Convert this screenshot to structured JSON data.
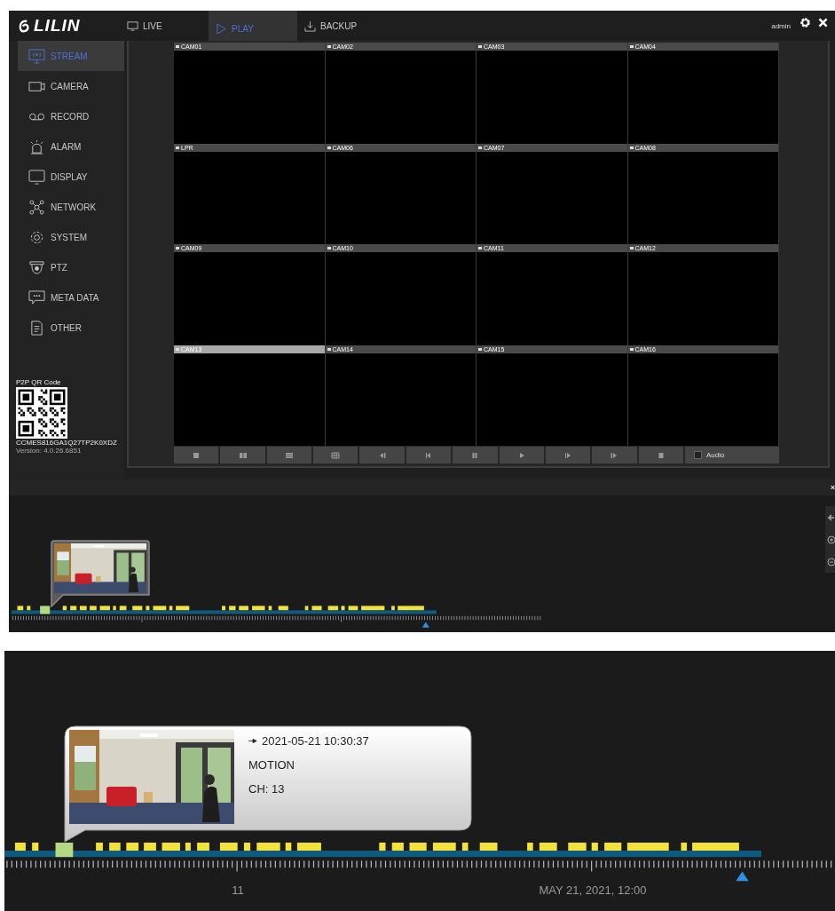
{
  "header": {
    "logo": "LILIN",
    "user": "admin",
    "tabs": [
      {
        "label": "LIVE",
        "kind": "monitor",
        "selected": false
      },
      {
        "label": "PLAY",
        "kind": "play",
        "selected": true
      },
      {
        "label": "BACKUP",
        "kind": "download",
        "selected": false
      }
    ]
  },
  "sidebar": {
    "items": [
      {
        "label": "STREAM",
        "kind": "stream",
        "selected": true
      },
      {
        "label": "CAMERA",
        "kind": "camera",
        "selected": false
      },
      {
        "label": "RECORD",
        "kind": "record",
        "selected": false
      },
      {
        "label": "ALARM",
        "kind": "alarm",
        "selected": false
      },
      {
        "label": "DISPLAY",
        "kind": "display",
        "selected": false
      },
      {
        "label": "NETWORK",
        "kind": "network",
        "selected": false
      },
      {
        "label": "SYSTEM",
        "kind": "system",
        "selected": false
      },
      {
        "label": "PTZ",
        "kind": "ptz",
        "selected": false
      },
      {
        "label": "META DATA",
        "kind": "meta",
        "selected": false
      },
      {
        "label": "OTHER",
        "kind": "other",
        "selected": false
      }
    ],
    "qr": {
      "title": "P2P QR Code",
      "code": "CCMES816GA1Q27TP2K0XDZ",
      "version": "Version: 4.0.26.6851"
    }
  },
  "cameras": [
    {
      "label": "CAM01",
      "selected": false
    },
    {
      "label": "CAM02",
      "selected": false
    },
    {
      "label": "CAM03",
      "selected": false
    },
    {
      "label": "CAM04",
      "selected": false
    },
    {
      "label": "LPR",
      "selected": false
    },
    {
      "label": "CAM06",
      "selected": false
    },
    {
      "label": "CAM07",
      "selected": false
    },
    {
      "label": "CAM08",
      "selected": false
    },
    {
      "label": "CAM09",
      "selected": false
    },
    {
      "label": "CAM10",
      "selected": false
    },
    {
      "label": "CAM11",
      "selected": false
    },
    {
      "label": "CAM12",
      "selected": false
    },
    {
      "label": "CAM13",
      "selected": true
    },
    {
      "label": "CAM14",
      "selected": false
    },
    {
      "label": "CAM15",
      "selected": false
    },
    {
      "label": "CAM16",
      "selected": false
    }
  ],
  "controls": [
    {
      "kind": "single"
    },
    {
      "kind": "split"
    },
    {
      "kind": "rows"
    },
    {
      "kind": "grid"
    },
    {
      "kind": "rewind"
    },
    {
      "kind": "step-back"
    },
    {
      "kind": "pause"
    },
    {
      "kind": "play"
    },
    {
      "kind": "step-forward"
    },
    {
      "kind": "fast-forward"
    },
    {
      "kind": "stop"
    }
  ],
  "audio": {
    "label": "Audio",
    "checked": false
  },
  "event_popup": {
    "time": "2021-05-21 10:30:37",
    "event": "MOTION",
    "channel": "CH: 13"
  },
  "timeline_labels": [
    "11",
    "MAY 21, 2021, 12:00"
  ]
}
